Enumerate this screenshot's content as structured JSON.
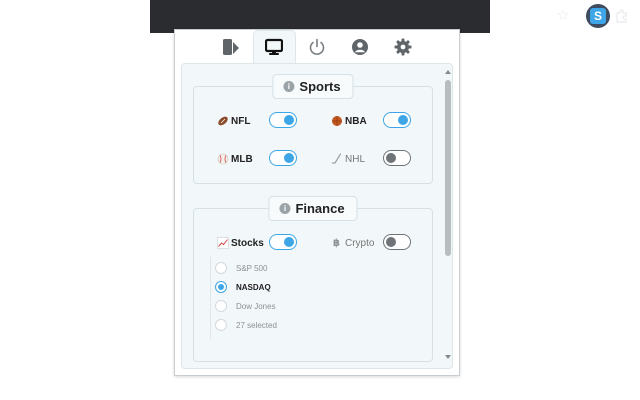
{
  "browser": {
    "star_icon": "star-icon",
    "extension_logo": "S",
    "extensions_icon": "puzzle-icon"
  },
  "tabs": [
    {
      "icon": "sidebar-layout-icon",
      "active": false
    },
    {
      "icon": "monitor-icon",
      "active": true
    },
    {
      "icon": "power-icon",
      "active": false
    },
    {
      "icon": "account-icon",
      "active": false
    },
    {
      "icon": "gear-icon",
      "active": false
    }
  ],
  "sports": {
    "title": "Sports",
    "info_icon": "i",
    "items": [
      {
        "label": "NFL",
        "icon": "football-icon",
        "enabled": true
      },
      {
        "label": "NBA",
        "icon": "basketball-icon",
        "enabled": true
      },
      {
        "label": "MLB",
        "icon": "baseball-icon",
        "enabled": true
      },
      {
        "label": "NHL",
        "icon": "hockey-icon",
        "enabled": false
      }
    ]
  },
  "finance": {
    "title": "Finance",
    "info_icon": "i",
    "items": [
      {
        "label": "Stocks",
        "icon": "chart-icon",
        "enabled": true
      },
      {
        "label": "Crypto",
        "icon": "bitcoin-icon",
        "enabled": false
      }
    ],
    "options": [
      {
        "label": "S&P 500",
        "selected": false
      },
      {
        "label": "NASDAQ",
        "selected": true
      },
      {
        "label": "Dow Jones",
        "selected": false
      },
      {
        "label": "27 selected",
        "selected": false
      }
    ]
  },
  "colors": {
    "accent": "#3ea6e6",
    "toggle_off": "#6e7478",
    "panel_bg": "#f2f7f9",
    "browser_bar": "#2b2c2f"
  }
}
